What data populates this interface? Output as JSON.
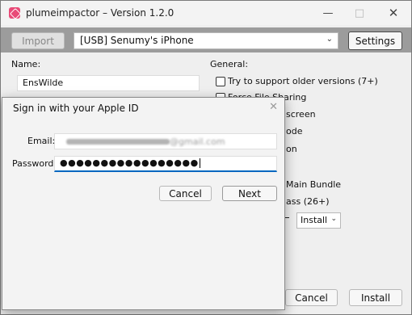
{
  "window": {
    "title": "plumeimpactor – Version 1.2.0"
  },
  "toolbar": {
    "import_label": "Import",
    "device": "[USB] Senumy's iPhone",
    "settings_label": "Settings"
  },
  "form": {
    "name_label": "Name:",
    "name_value": "EnsWilde",
    "general_label": "General:",
    "options": [
      {
        "text": "Try to support older versions (7+)",
        "checked": false
      },
      {
        "text": "Force File Sharing",
        "checked": false
      },
      {
        "text": "screen",
        "checked": false
      },
      {
        "text": "ode",
        "checked": false
      },
      {
        "text": "on",
        "checked": false
      },
      {
        "text": "Main Bundle",
        "checked": false
      },
      {
        "text": "ass (26+)",
        "checked": false
      }
    ],
    "install_mode": "Install"
  },
  "footer": {
    "cancel_label": "Cancel",
    "install_label": "Install"
  },
  "dialog": {
    "title": "Sign in with your Apple ID",
    "email_label": "Email:",
    "email_value": "@gmail.com",
    "password_label": "Password:",
    "password_value": "●●●●●●●●●●●●●●●●●",
    "cancel_label": "Cancel",
    "next_label": "Next"
  },
  "colors": {
    "accent": "#0067c0",
    "toolbar_bg": "#9c9c9c",
    "app_icon": "#e84a77"
  }
}
